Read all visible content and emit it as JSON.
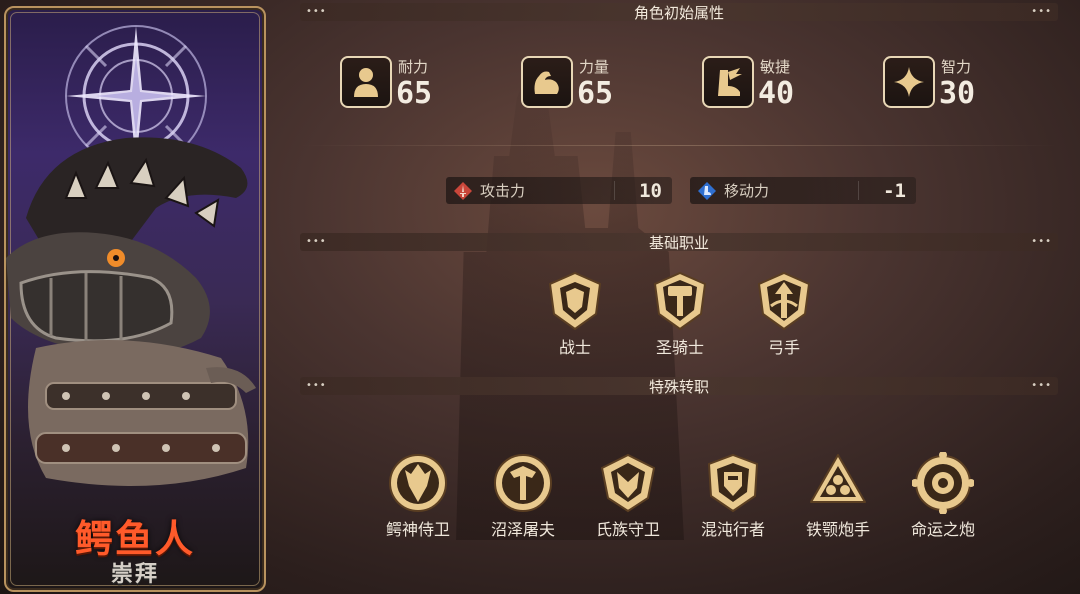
{
  "character": {
    "name": "鳄鱼人",
    "subtitle": "崇拜"
  },
  "sections": {
    "attributes_title": "角色初始属性",
    "base_class_title": "基础职业",
    "special_class_title": "特殊转职"
  },
  "attributes": [
    {
      "label": "耐力",
      "value": "65",
      "icon": "person-icon"
    },
    {
      "label": "力量",
      "value": "65",
      "icon": "arm-muscle-icon"
    },
    {
      "label": "敏捷",
      "value": "40",
      "icon": "winged-boot-icon"
    },
    {
      "label": "智力",
      "value": "30",
      "icon": "sparkle-icon"
    }
  ],
  "stats": [
    {
      "label": "攻击力",
      "value": "10",
      "icon": "sword-badge-icon",
      "color": "#c9463a"
    },
    {
      "label": "移动力",
      "value": "-1",
      "icon": "boot-badge-icon",
      "color": "#2f6fd0"
    }
  ],
  "base_classes": [
    {
      "label": "战士",
      "icon": "shield-crest-icon"
    },
    {
      "label": "圣骑士",
      "icon": "hammer-crest-icon"
    },
    {
      "label": "弓手",
      "icon": "arrow-crest-icon"
    }
  ],
  "special_classes": [
    {
      "label": "鳄神侍卫",
      "icon": "croc-guard-crest-icon"
    },
    {
      "label": "沼泽屠夫",
      "icon": "swamp-butcher-crest-icon"
    },
    {
      "label": "氏族守卫",
      "icon": "clan-guard-crest-icon"
    },
    {
      "label": "混沌行者",
      "icon": "chaos-walker-crest-icon"
    },
    {
      "label": "铁颚炮手",
      "icon": "iron-jaw-crest-icon"
    },
    {
      "label": "命运之炮",
      "icon": "fate-cannon-crest-icon"
    }
  ],
  "colors": {
    "gold": "#e8c98e",
    "name_orange": "#ff5a2a",
    "card_purple": "#3d2a6a"
  }
}
